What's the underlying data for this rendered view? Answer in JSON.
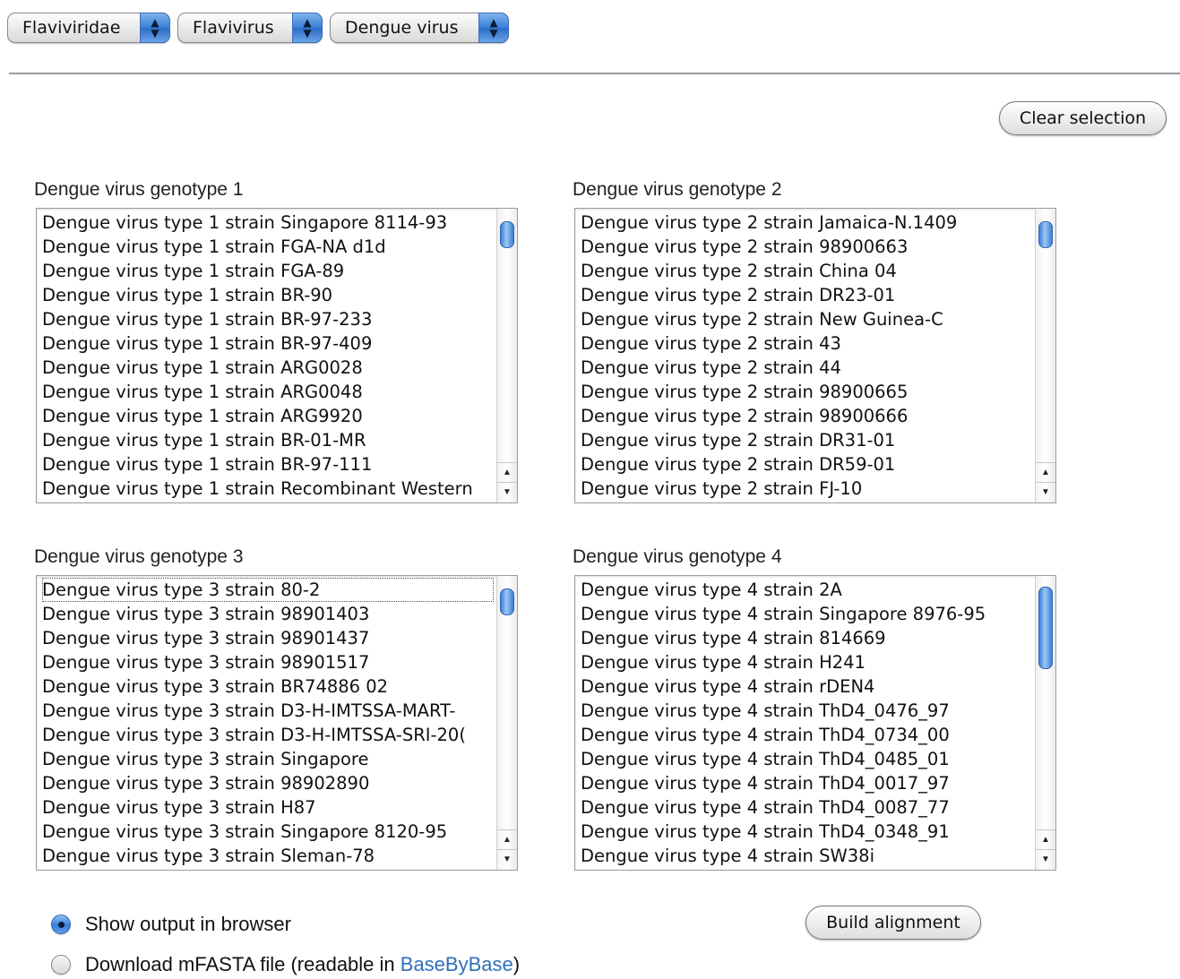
{
  "selectors": [
    {
      "value": "Flaviviridae"
    },
    {
      "value": "Flavivirus"
    },
    {
      "value": "Dengue virus"
    }
  ],
  "clear_button": "Clear selection",
  "groups": [
    {
      "label": "Dengue virus genotype 1",
      "items": [
        "Dengue virus type 1 strain Singapore 8114-93",
        "Dengue virus type 1 strain FGA-NA d1d",
        "Dengue virus type 1 strain FGA-89",
        "Dengue virus type 1 strain BR-90",
        "Dengue virus type 1 strain BR-97-233",
        "Dengue virus type 1 strain BR-97-409",
        "Dengue virus type 1 strain ARG0028",
        "Dengue virus type 1 strain ARG0048",
        "Dengue virus type 1 strain ARG9920",
        "Dengue virus type 1 strain BR-01-MR",
        "Dengue virus type 1 strain BR-97-111",
        "Dengue virus type 1 strain Recombinant Western"
      ]
    },
    {
      "label": "Dengue virus genotype 2",
      "items": [
        "Dengue virus type 2 strain Jamaica-N.1409",
        "Dengue virus type 2 strain 98900663",
        "Dengue virus type 2 strain China 04",
        "Dengue virus type 2 strain DR23-01",
        "Dengue virus type 2 strain New Guinea-C",
        "Dengue virus type 2 strain 43",
        "Dengue virus type 2 strain 44",
        "Dengue virus type 2 strain 98900665",
        "Dengue virus type 2 strain 98900666",
        "Dengue virus type 2 strain DR31-01",
        "Dengue virus type 2 strain DR59-01",
        "Dengue virus type 2 strain FJ-10"
      ]
    },
    {
      "label": "Dengue virus genotype 3",
      "items": [
        "Dengue virus type 3 strain 80-2",
        "Dengue virus type 3 strain 98901403",
        "Dengue virus type 3 strain 98901437",
        "Dengue virus type 3 strain 98901517",
        "Dengue virus type 3 strain BR74886 02",
        "Dengue virus type 3 strain D3-H-IMTSSA-MART-",
        "Dengue virus type 3 strain D3-H-IMTSSA-SRI-20(",
        "Dengue virus type 3 strain Singapore",
        "Dengue virus type 3 strain 98902890",
        "Dengue virus type 3 strain H87",
        "Dengue virus type 3 strain Singapore 8120-95",
        "Dengue virus type 3 strain Sleman-78"
      ]
    },
    {
      "label": "Dengue virus genotype 4",
      "items": [
        "Dengue virus type 4 strain 2A",
        "Dengue virus type 4 strain Singapore 8976-95",
        "Dengue virus type 4 strain 814669",
        "Dengue virus type 4 strain H241",
        "Dengue virus type 4 strain rDEN4",
        "Dengue virus type 4 strain ThD4_0476_97",
        "Dengue virus type 4 strain ThD4_0734_00",
        "Dengue virus type 4 strain ThD4_0485_01",
        "Dengue virus type 4 strain ThD4_0017_97",
        "Dengue virus type 4 strain ThD4_0087_77",
        "Dengue virus type 4 strain ThD4_0348_91",
        "Dengue virus type 4 strain SW38i"
      ]
    }
  ],
  "output": {
    "option_browser": "Show output in browser",
    "option_download_prefix": "Download mFASTA file (readable in ",
    "option_download_link": "BaseByBase",
    "option_download_suffix": ")",
    "selected": "browser"
  },
  "build_button": "Build alignment"
}
